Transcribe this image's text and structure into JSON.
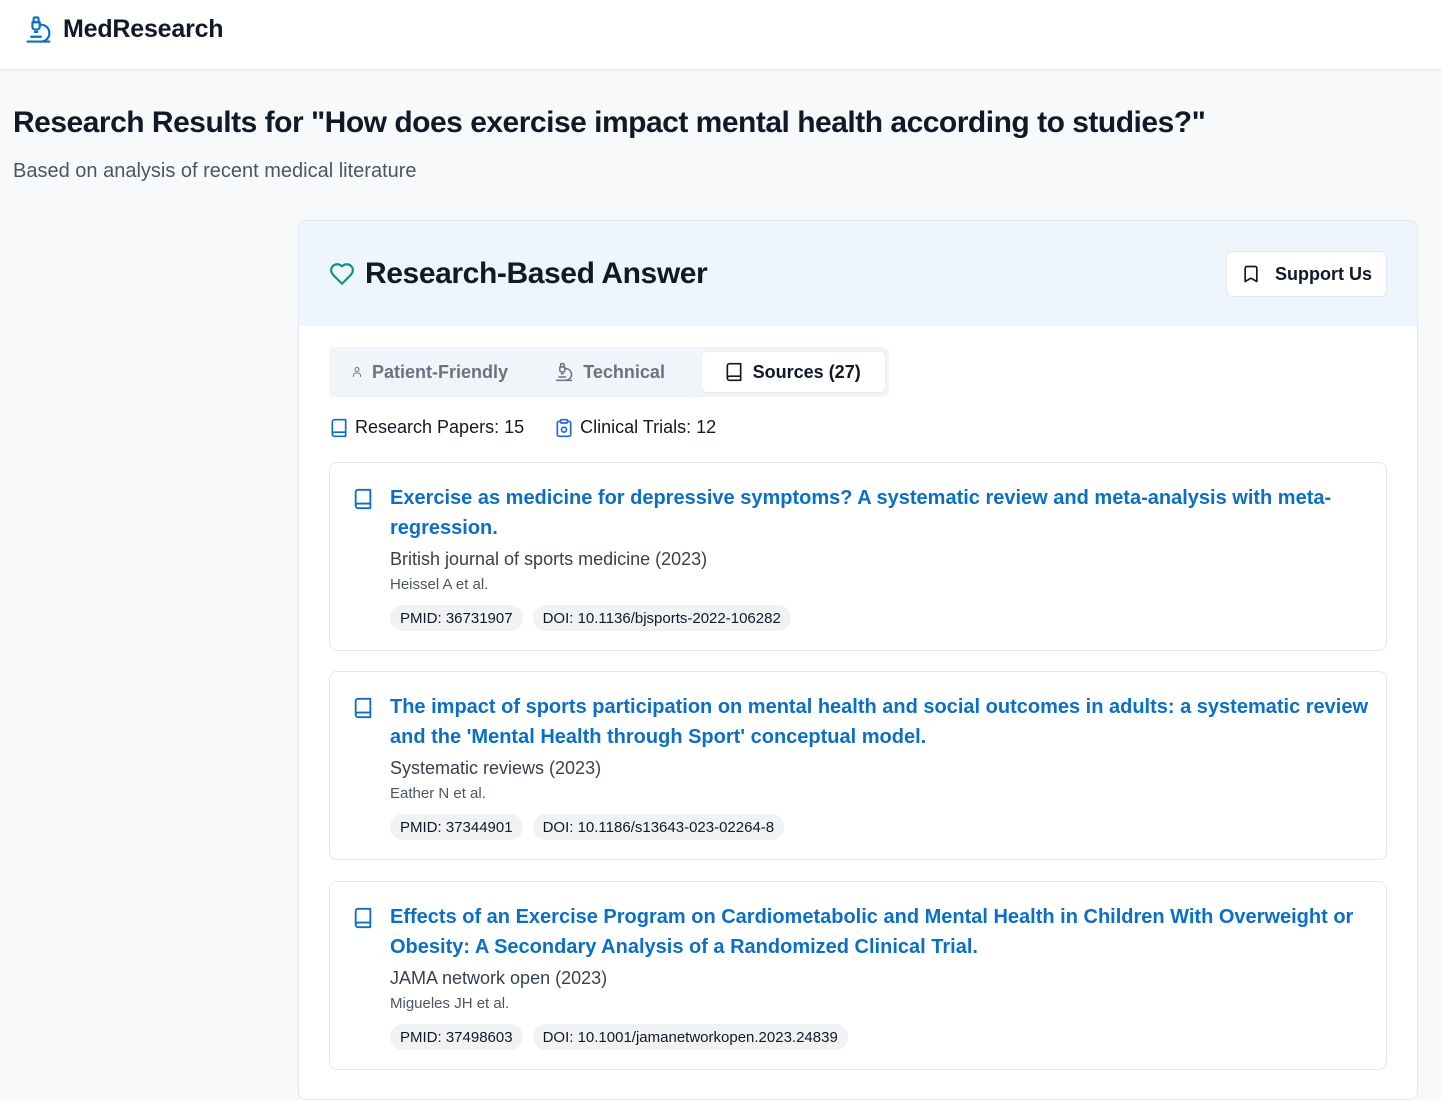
{
  "app": {
    "name": "MedResearch",
    "logo_icon": "microscope-icon"
  },
  "page": {
    "title": "Research Results for \"How does exercise impact mental health according to studies?\"",
    "subtitle": "Based on analysis of recent medical literature"
  },
  "panel": {
    "title": "Research-Based Answer",
    "title_icon": "heart-icon",
    "support_label": "Support Us",
    "support_icon": "bookmark-icon"
  },
  "tabs": [
    {
      "label": "Patient-Friendly",
      "icon": "person-icon",
      "active": false
    },
    {
      "label": "Technical",
      "icon": "microscope-icon",
      "active": false
    },
    {
      "label": "Sources (27)",
      "icon": "book-icon",
      "active": true
    }
  ],
  "stats": {
    "papers_label": "Research Papers: 15",
    "trials_label": "Clinical Trials: 12"
  },
  "sources": [
    {
      "title": "Exercise as medicine for depressive symptoms? A systematic review and meta-analysis with meta-regression.",
      "journal": "British journal of sports medicine (2023)",
      "authors": "Heissel A et al.",
      "pmid": "PMID: 36731907",
      "doi": "DOI: 10.1136/bjsports-2022-106282"
    },
    {
      "title": "The impact of sports participation on mental health and social outcomes in adults: a systematic review and the 'Mental Health through Sport' conceptual model.",
      "journal": "Systematic reviews (2023)",
      "authors": "Eather N et al.",
      "pmid": "PMID: 37344901",
      "doi": "DOI: 10.1186/s13643-023-02264-8"
    },
    {
      "title": "Effects of an Exercise Program on Cardiometabolic and Mental Health in Children With Overweight or Obesity: A Secondary Analysis of a Randomized Clinical Trial.",
      "journal": "JAMA network open (2023)",
      "authors": "Migueles JH et al.",
      "pmid": "PMID: 37498603",
      "doi": "DOI: 10.1001/jamanetworkopen.2023.24839"
    }
  ],
  "colors": {
    "brand_blue": "#0b6fc7",
    "heart_teal": "#0d9488",
    "header_bg": "#eef5fd"
  }
}
